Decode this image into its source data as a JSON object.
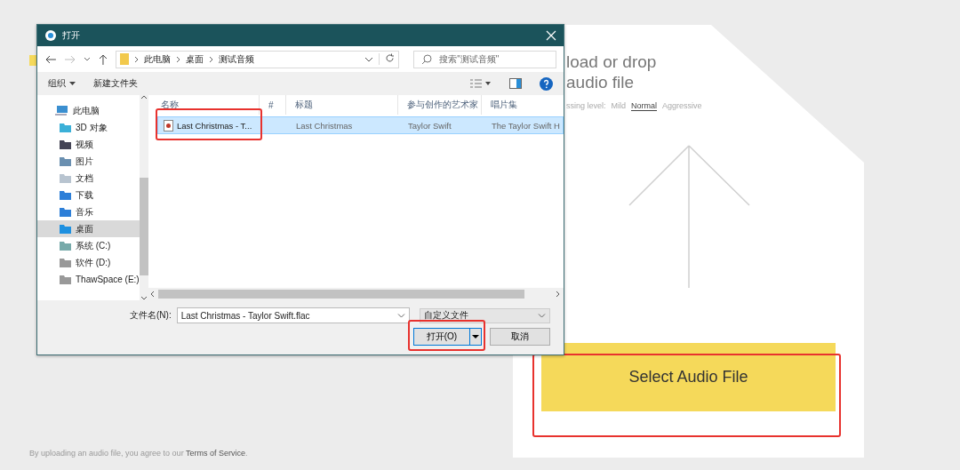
{
  "page": {
    "footer": {
      "text": "By uploading an audio file, you agree to our ",
      "link": "Terms of Service",
      "end": "."
    }
  },
  "upload_card": {
    "title_lines": [
      "load or drop",
      "audio file"
    ],
    "level_label": "ssing level:",
    "levels": [
      {
        "label": "Mild",
        "selected": false
      },
      {
        "label": "Normal",
        "selected": true
      },
      {
        "label": "Aggressive",
        "selected": false
      }
    ],
    "button": "Select Audio File"
  },
  "dialog": {
    "title": "打开",
    "path": [
      "此电脑",
      "桌面",
      "测试音频"
    ],
    "search": {
      "placeholder": "搜索\"测试音频\""
    },
    "toolbar": [
      {
        "label": "组织",
        "dropdown": true
      },
      {
        "label": "新建文件夹"
      }
    ],
    "nav": [
      {
        "label": "此电脑",
        "selected": false,
        "children": [
          {
            "label": "3D 对象",
            "selected": false
          },
          {
            "label": "视频",
            "selected": false
          },
          {
            "label": "图片",
            "selected": false
          },
          {
            "label": "文档",
            "selected": false
          },
          {
            "label": "下载",
            "selected": false
          },
          {
            "label": "音乐",
            "selected": false
          },
          {
            "label": "桌面",
            "selected": true
          },
          {
            "label": "系统 (C:)",
            "selected": false
          },
          {
            "label": "软件 (D:)",
            "selected": false
          },
          {
            "label": "ThawSpace (E:)",
            "selected": false
          }
        ]
      }
    ],
    "columns": [
      "名称",
      "#",
      "标题",
      "参与创作的艺术家",
      "唱片集"
    ],
    "rows": [
      {
        "name": "Last Christmas - T...",
        "title": "Last Christmas",
        "artist": "Taylor Swift",
        "album": "The Taylor Swift H",
        "selected": true
      }
    ],
    "filename_label": "文件名(N):",
    "filename": "Last Christmas - Taylor Swift.flac",
    "filetype": "自定义文件",
    "open_button": "打开(O)",
    "cancel_button": "取消"
  }
}
